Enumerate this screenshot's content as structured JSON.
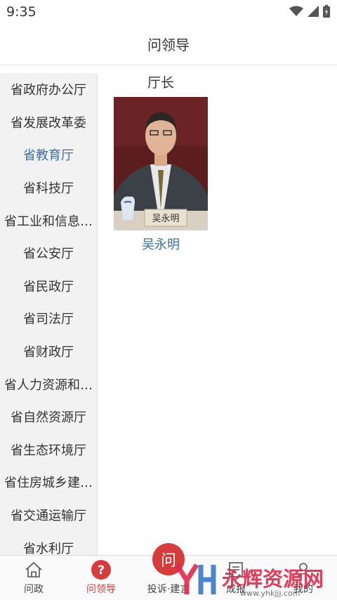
{
  "status": {
    "time": "9:35"
  },
  "appbar": {
    "title": "问领导"
  },
  "sidebar": {
    "items": [
      {
        "label": "省政府办公厅"
      },
      {
        "label": "省发展改革委"
      },
      {
        "label": "省教育厅"
      },
      {
        "label": "省科技厅"
      },
      {
        "label": "省工业和信息…"
      },
      {
        "label": "省公安厅"
      },
      {
        "label": "省民政厅"
      },
      {
        "label": "省司法厅"
      },
      {
        "label": "省财政厅"
      },
      {
        "label": "省人力资源和…"
      },
      {
        "label": "省自然资源厅"
      },
      {
        "label": "省生态环境厅"
      },
      {
        "label": "省住房城乡建…"
      },
      {
        "label": "省交通运输厅"
      },
      {
        "label": "省水利厅"
      }
    ],
    "active_index": 2
  },
  "leader": {
    "role": "厅长",
    "name": "吴永明",
    "nameplate": "吴永明"
  },
  "tabbar": {
    "tabs": [
      {
        "label": "问政",
        "icon": "home-icon"
      },
      {
        "label": "问领导",
        "icon": "question-circle-icon"
      },
      {
        "label": "投诉·建言",
        "icon": "ask-fab-icon"
      },
      {
        "label": "成报",
        "icon": "report-icon"
      },
      {
        "label": "我的",
        "icon": "user-icon"
      }
    ],
    "fab_label": "问"
  },
  "watermark": {
    "brand": "永辉资源网",
    "url": "www.yhkjjj.com"
  },
  "colors": {
    "accent_blue": "#3b6ea8",
    "accent_red": "#d83b3b",
    "sidebar_bg": "#f2f2f2"
  }
}
